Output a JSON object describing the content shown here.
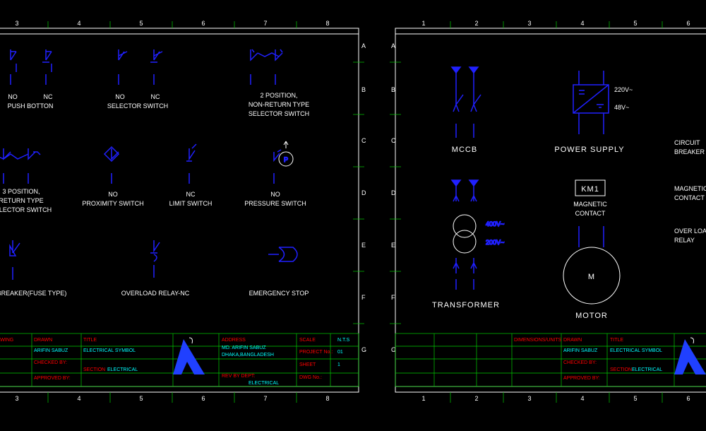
{
  "left": {
    "cols": [
      "3",
      "4",
      "5",
      "6",
      "7",
      "8"
    ],
    "rows": [
      "A",
      "B",
      "C",
      "D",
      "E",
      "F",
      "G"
    ],
    "sym": {
      "pb_no": "NO",
      "pb_nc": "NC",
      "push": "PUSH BOTTON",
      "ss_no": "NO",
      "ss_nc": "NC",
      "sel": "SELECTOR SWITCH",
      "pos2a": "2 POSITION,",
      "pos2b": "NON-RETURN TYPE",
      "pos2c": "SELECTOR SWITCH",
      "pos3a": "3 POSITION,",
      "pos3b": "RETURN TYPE",
      "pos3c": "SELECTOR SWITCH",
      "prox_no": "NO",
      "prox": "PROXIMITY SWITCH",
      "lim_nc": "NC",
      "lim": "LIMIT SWITCH",
      "pres_no": "NO",
      "pres": "PRESSURE SWITCH",
      "brk": "BREAKER(FUSE TYPE)",
      "ovr": "OVERLOAD RELAY-NC",
      "estop": "EMERGENCY STOP"
    },
    "title": {
      "drawn": "ARIFIN SABUZ",
      "drawn_lbl": "DRAWN",
      "checked_lbl": "CHECKED BY:",
      "approved_lbl": "APPROVED BY:",
      "ttl_lbl": "TITLE",
      "ttl": "ELECTRICAL SYMBOL",
      "sec_lbl": "SECTION",
      "sec": "ELECTRICAL",
      "addr_lbl": "ADDRESS",
      "addr1": "MD. ARIFIN SABUZ",
      "addr2": "DHAKA,BANGLADESH",
      "scale_lbl": "SCALE",
      "scale": "N.T.S",
      "proj_lbl": "PROJECT No.:",
      "proj": "01",
      "sheet_lbl": "SHEET",
      "sheet": "1",
      "rev_lbl": "REV BY DEPT:",
      "dwg_lbl": "DWG No.:"
    }
  },
  "right": {
    "cols": [
      "1",
      "2",
      "3",
      "4",
      "5",
      "6"
    ],
    "rows": [
      "A",
      "B",
      "C",
      "D",
      "E",
      "F",
      "G"
    ],
    "sym": {
      "mccb": "MCCB",
      "ps": "POWER SUPPLY",
      "v220": "220V~",
      "v48": "48V~",
      "cb1": "CIRCUIT",
      "cb2": "BREAKER",
      "km1": "KM1",
      "mc1": "MAGNETIC",
      "mc2": "CONTACT",
      "mc1b": "MAGNETIC",
      "mc2b": "CONTACT",
      "ol1": "OVER LOAD",
      "ol2": "RELAY",
      "v400": "400V~",
      "v200": "200V~",
      "xfmr": "TRANSFORMER",
      "m": "M",
      "motor": "MOTOR"
    },
    "title": {
      "drawn": "ARIFIN SABUZ",
      "drawn_lbl": "DRAWN",
      "checked_lbl": "CHECKED BY:",
      "approved_lbl": "APPROVED BY:",
      "ttl_lbl": "TITLE",
      "ttl": "ELECTRICAL SYMBOL",
      "sec_lbl": "SECTION",
      "sec": "ELECTRICAL",
      "dim_lbl": "DIMENSIONS/UNITS"
    }
  }
}
